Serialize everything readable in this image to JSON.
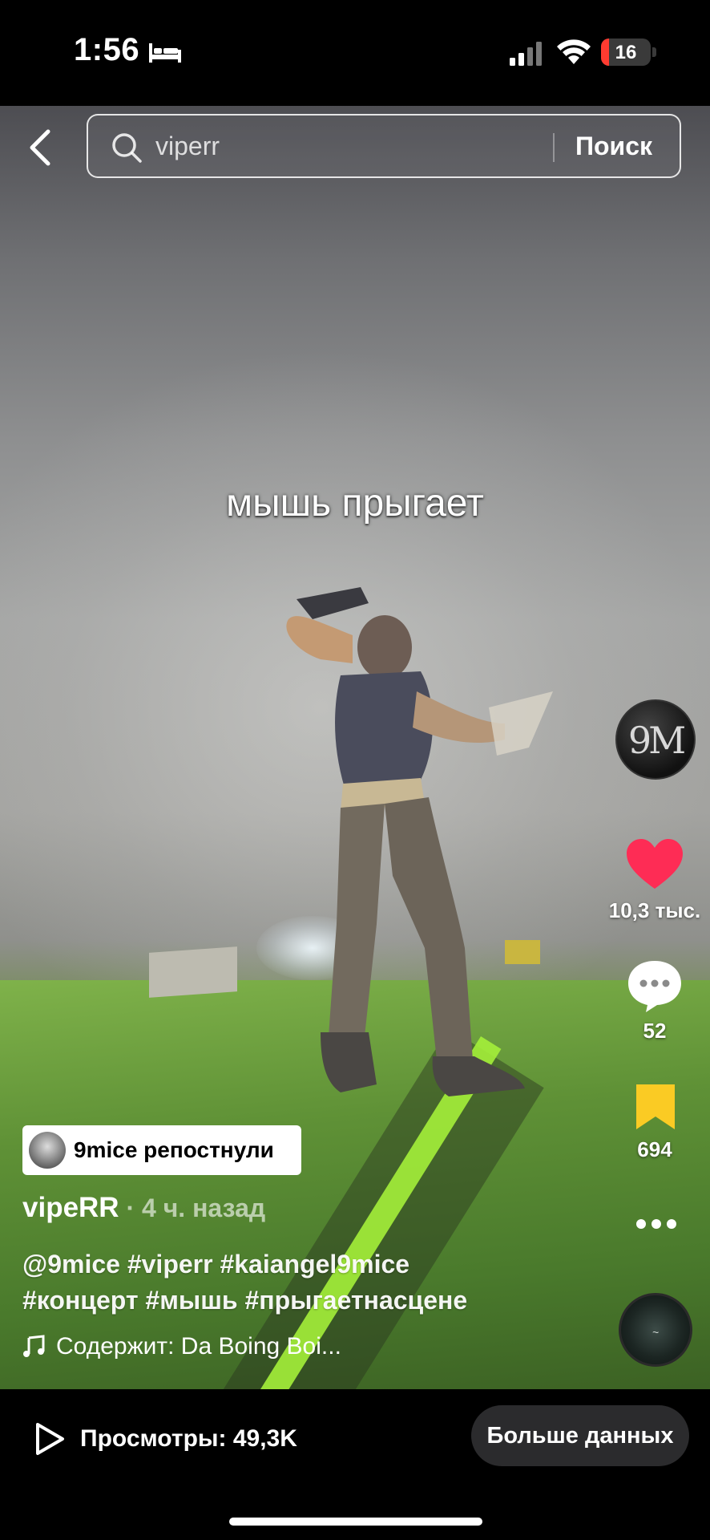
{
  "status_bar": {
    "time": "1:56",
    "battery_level": "16",
    "icons": [
      "bed-icon",
      "cellular-signal-icon",
      "wifi-icon",
      "battery-icon"
    ]
  },
  "search": {
    "query": "viperr",
    "button_label": "Поиск"
  },
  "video": {
    "caption_overlay": "мышь прыгает"
  },
  "actions": {
    "creator_avatar_text": "9M",
    "likes": "10,3 тыс.",
    "comments": "52",
    "favorites": "694",
    "accent_like": "#fe2c55",
    "accent_bookmark": "#facb24"
  },
  "post": {
    "repost_label": "9mice репостнули",
    "author": "vipeRR",
    "time_ago": " · 4 ч. назад",
    "description_line1": "@9mice #viperr #kaiangel9mice",
    "description_line2": "#концерт #мышь #прыгаетнасцене",
    "music": "Содержит: Da Boing Boi..."
  },
  "bottom": {
    "views": "Просмотры: 49,3K",
    "more_data_label": "Больше данных"
  }
}
